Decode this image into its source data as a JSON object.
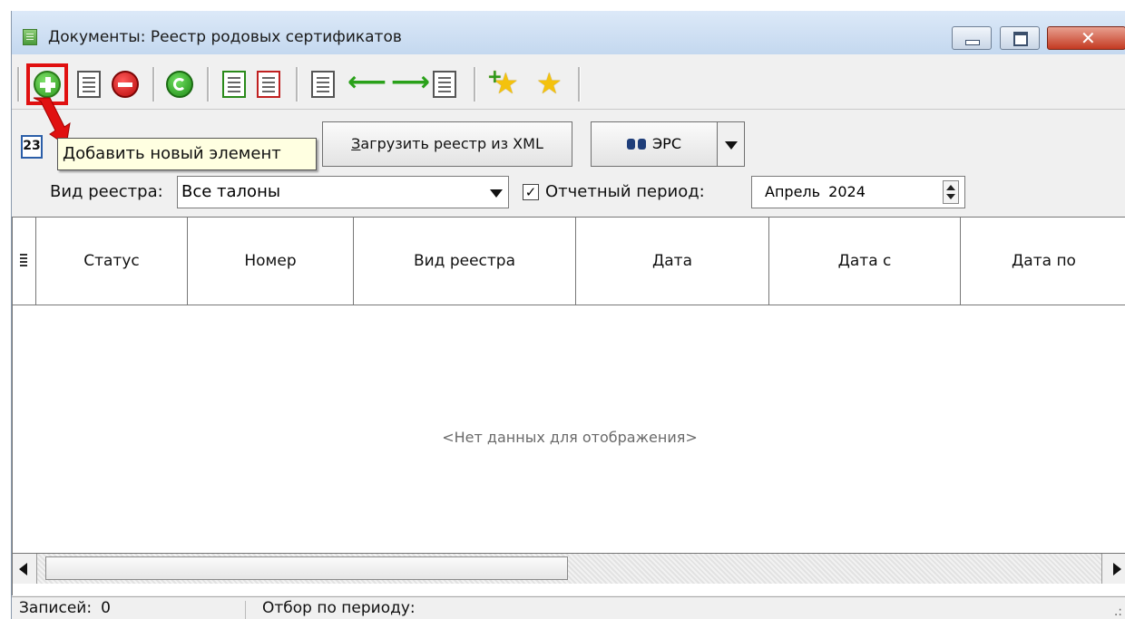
{
  "window": {
    "title": "Документы: Реестр родовых сертификатов",
    "close_glyph": "✕"
  },
  "toolbar": {
    "icons": [
      "add-icon",
      "edit-icon",
      "delete-icon",
      "refresh-icon",
      "approve-icon",
      "reject-icon",
      "export-icon",
      "arrow-left-icon",
      "arrow-right-icon",
      "import-icon",
      "star-add-icon",
      "star-icon"
    ],
    "left_arrow": "⟵",
    "right_arrow": "⟶",
    "star": "★"
  },
  "toolbar2": {
    "calendar_label": "23",
    "load_xml_prefix": "З",
    "load_xml_rest": "агрузить реестр из XML",
    "ers_label": "ЭРС"
  },
  "tooltip": {
    "text": "Добавить новый элемент"
  },
  "filters": {
    "registry_type_label": "Вид реестра:",
    "registry_type_value": "Все талоны",
    "period_checked": true,
    "period_check_glyph": "✓",
    "period_label": "Отчетный период:",
    "period_value": "Апрель  2024"
  },
  "grid": {
    "columns": [
      "Статус",
      "Номер",
      "Вид реестра",
      "Дата",
      "Дата с",
      "Дата по"
    ],
    "empty_message": "<Нет данных для отображения>"
  },
  "status": {
    "records_label": "Записей:",
    "records_value": "0",
    "filter_label": "Отбор по периоду:",
    "grip": ".:"
  },
  "colors": {
    "highlight": "#e01010",
    "tooltip_bg": "#ffffe1"
  }
}
